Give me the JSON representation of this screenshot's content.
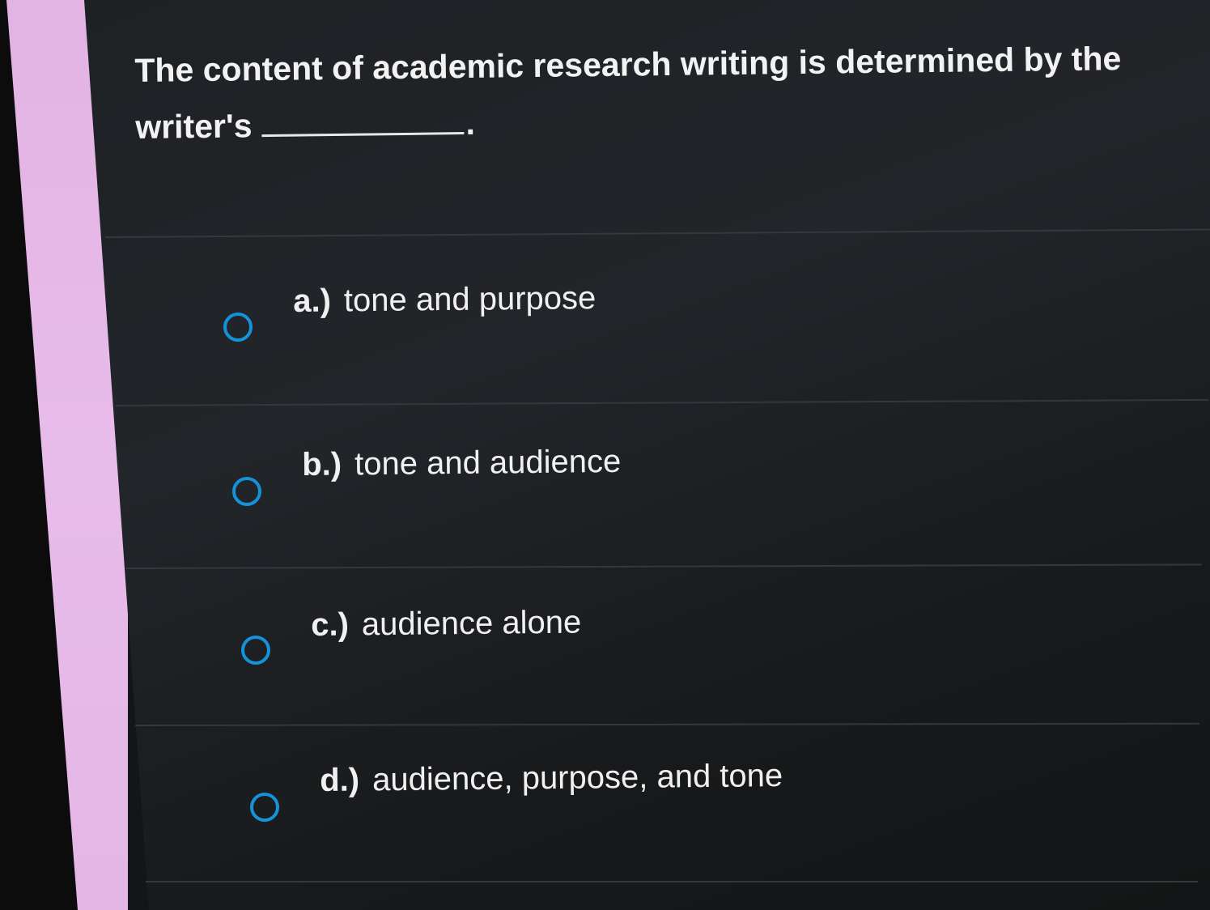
{
  "question": {
    "line1": "The content of academic research writing is determined by the",
    "line2_prefix": "writer's",
    "line2_suffix": "."
  },
  "options": [
    {
      "letter": "a.)",
      "text": "tone and purpose"
    },
    {
      "letter": "b.)",
      "text": "tone and audience"
    },
    {
      "letter": "c.)",
      "text": "audience alone"
    },
    {
      "letter": "d.)",
      "text": "audience, purpose, and tone"
    }
  ],
  "colors": {
    "radio": "#1592d8",
    "background": "#1e2124",
    "side_strip": "#e6b8e8"
  },
  "icons": {
    "radio": "radio-button-unselected-icon"
  }
}
